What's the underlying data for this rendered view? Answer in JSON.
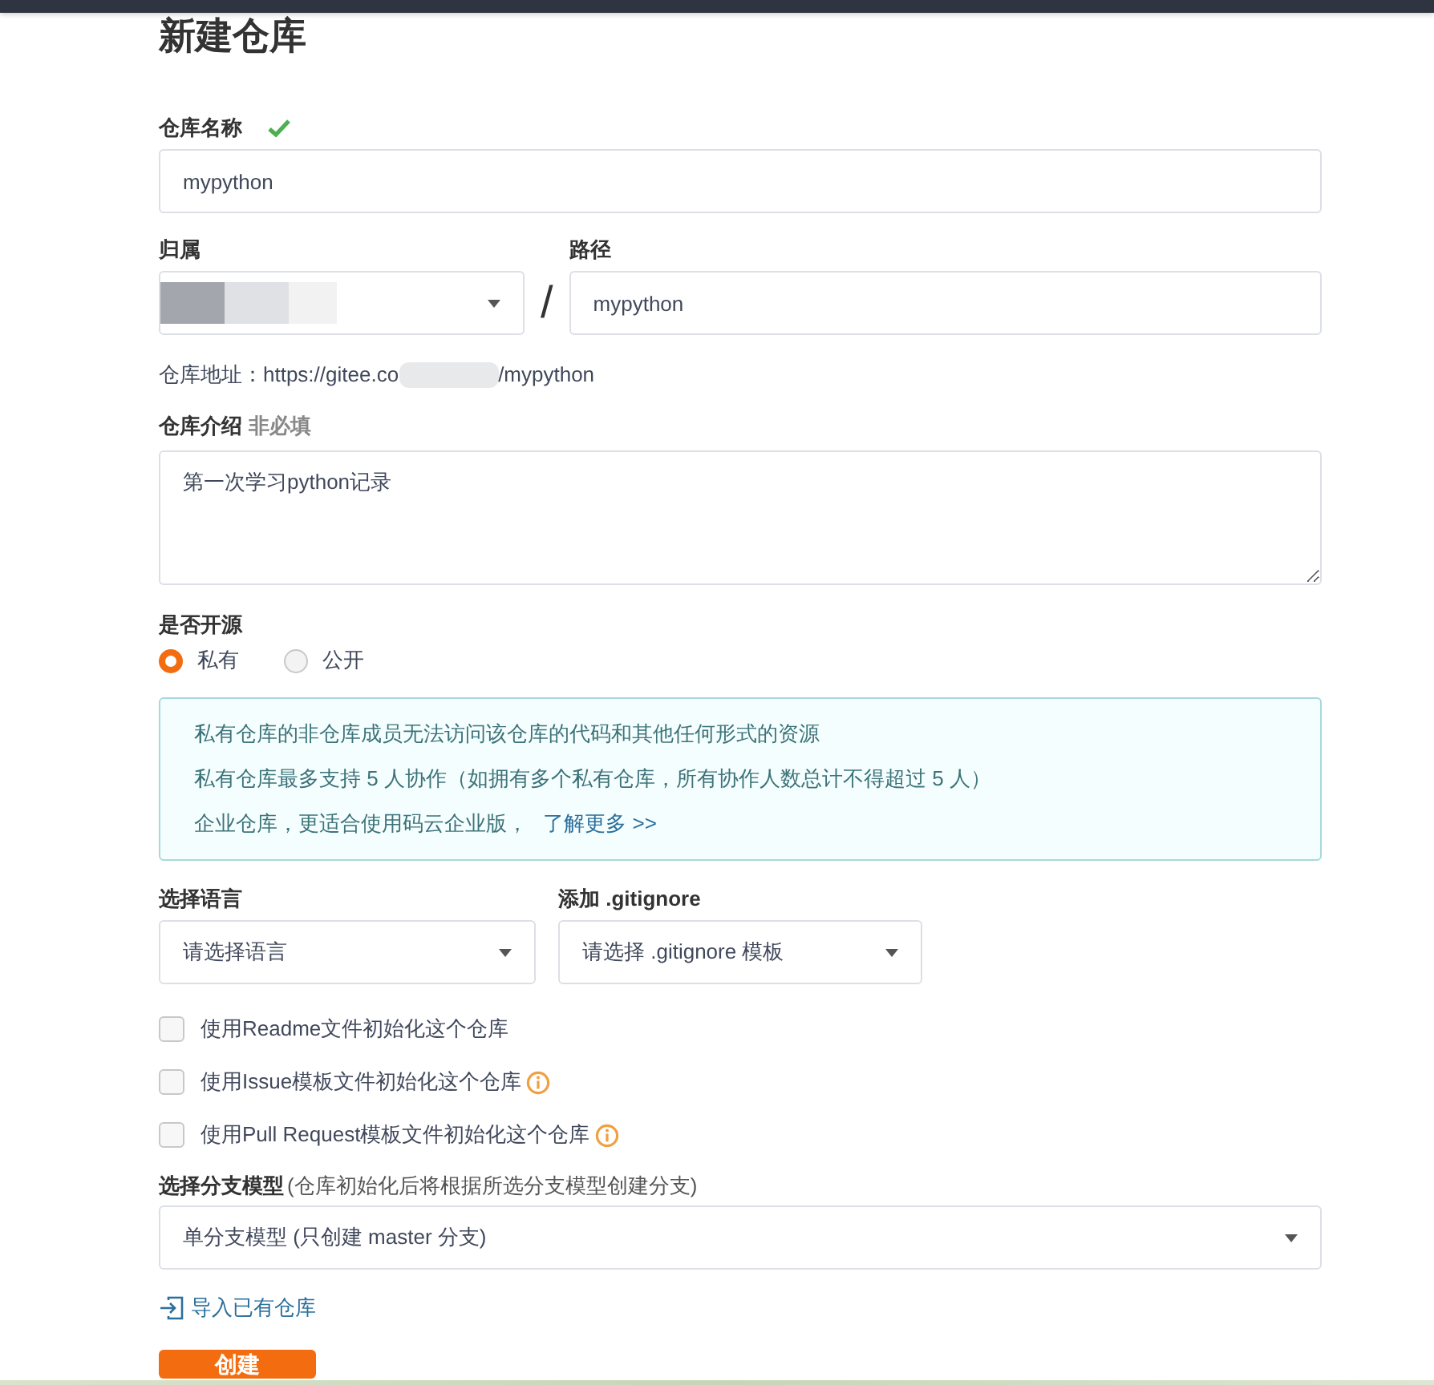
{
  "title": "新建仓库",
  "name_field": {
    "label": "仓库名称",
    "valid": true,
    "value": "mypython"
  },
  "owner": {
    "label": "归属"
  },
  "separator": "/",
  "path_field": {
    "label": "路径",
    "value": "mypython"
  },
  "repo_url": {
    "prefix": "仓库地址：https://gitee.co",
    "suffix": "/mypython"
  },
  "description": {
    "label": "仓库介绍",
    "hint": "非必填",
    "value": "第一次学习python记录"
  },
  "visibility": {
    "label": "是否开源",
    "options": [
      {
        "label": "私有",
        "selected": true
      },
      {
        "label": "公开",
        "selected": false
      }
    ]
  },
  "notice": {
    "lines": [
      "私有仓库的非仓库成员无法访问该仓库的代码和其他任何形式的资源",
      "私有仓库最多支持 5 人协作（如拥有多个私有仓库，所有协作人数总计不得超过 5 人）",
      "企业仓库，更适合使用码云企业版，"
    ],
    "link": "了解更多 >>"
  },
  "language": {
    "label": "选择语言",
    "value": "请选择语言"
  },
  "gitignore": {
    "label": "添加 .gitignore",
    "value": "请选择 .gitignore 模板"
  },
  "init_options": [
    {
      "label": "使用Readme文件初始化这个仓库",
      "checked": false,
      "info": false
    },
    {
      "label": "使用Issue模板文件初始化这个仓库",
      "checked": false,
      "info": true
    },
    {
      "label": "使用Pull Request模板文件初始化这个仓库",
      "checked": false,
      "info": true
    }
  ],
  "branch_model": {
    "label": "选择分支模型",
    "hint": "(仓库初始化后将根据所选分支模型创建分支)",
    "value": "单分支模型 (只创建 master 分支)"
  },
  "import_link": "导入已有仓库",
  "submit": "创建"
}
